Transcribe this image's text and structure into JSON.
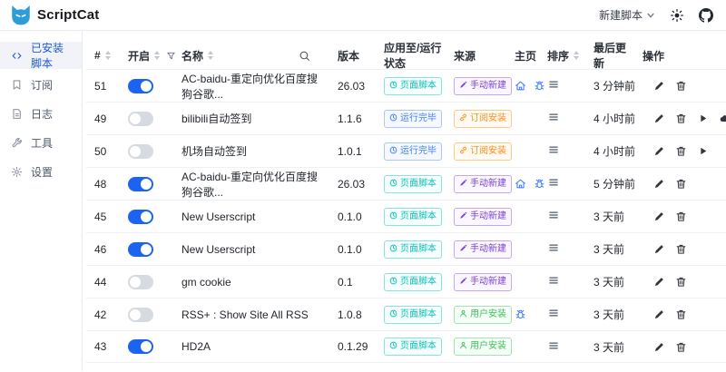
{
  "app": {
    "name": "ScriptCat"
  },
  "header": {
    "new_script_button": "新建脚本",
    "icons": [
      "chevron-down-icon",
      "theme-sun-icon",
      "github-icon"
    ]
  },
  "sidebar": {
    "items": [
      {
        "label": "已安装脚本",
        "icon": "code-icon",
        "active": true
      },
      {
        "label": "订阅",
        "icon": "subscribe-icon",
        "active": false
      },
      {
        "label": "日志",
        "icon": "logs-icon",
        "active": false
      },
      {
        "label": "工具",
        "icon": "tools-icon",
        "active": false
      },
      {
        "label": "设置",
        "icon": "settings-icon",
        "active": false
      }
    ]
  },
  "table": {
    "columns": [
      {
        "label": "#",
        "sortable": true
      },
      {
        "label": "开启",
        "sortable": true,
        "filterable": true
      },
      {
        "label": "名称",
        "sortable": true,
        "searchable": true
      },
      {
        "label": "版本"
      },
      {
        "label": "应用至/运行状态"
      },
      {
        "label": "来源"
      },
      {
        "label": "主页"
      },
      {
        "label": "排序",
        "sortable": true
      },
      {
        "label": "最后更新"
      },
      {
        "label": "操作"
      }
    ],
    "rows": [
      {
        "id": "51",
        "enabled": true,
        "name": "AC-baidu-重定向优化百度搜狗谷歌...",
        "version": "26.03",
        "status": {
          "label": "页面脚本",
          "kind": "page",
          "icon": "clock-icon"
        },
        "source": {
          "label": "手动新建",
          "kind": "manual",
          "icon": "pencil-icon"
        },
        "homepage_icons": [
          "home-icon",
          "bug-icon"
        ],
        "updated": "3 分钟前",
        "actions": [
          "edit-icon",
          "delete-icon"
        ]
      },
      {
        "id": "49",
        "enabled": false,
        "name": "bilibili自动签到",
        "version": "1.1.6",
        "status": {
          "label": "运行完毕",
          "kind": "run",
          "icon": "clock-icon"
        },
        "source": {
          "label": "订阅安装",
          "kind": "subscribe",
          "icon": "link-icon"
        },
        "homepage_icons": [],
        "updated": "4 小时前",
        "actions": [
          "edit-icon",
          "delete-icon",
          "run-icon",
          "cloud-icon"
        ]
      },
      {
        "id": "50",
        "enabled": false,
        "name": "机场自动签到",
        "version": "1.0.1",
        "status": {
          "label": "运行完毕",
          "kind": "run",
          "icon": "clock-icon"
        },
        "source": {
          "label": "订阅安装",
          "kind": "subscribe",
          "icon": "link-icon"
        },
        "homepage_icons": [],
        "updated": "4 小时前",
        "actions": [
          "edit-icon",
          "delete-icon",
          "run-icon"
        ]
      },
      {
        "id": "48",
        "enabled": true,
        "name": "AC-baidu-重定向优化百度搜狗谷歌...",
        "version": "26.03",
        "status": {
          "label": "页面脚本",
          "kind": "page",
          "icon": "clock-icon"
        },
        "source": {
          "label": "手动新建",
          "kind": "manual",
          "icon": "pencil-icon"
        },
        "homepage_icons": [
          "home-icon",
          "bug-icon"
        ],
        "updated": "5 分钟前",
        "actions": [
          "edit-icon",
          "delete-icon"
        ]
      },
      {
        "id": "45",
        "enabled": true,
        "name": "New Userscript",
        "version": "0.1.0",
        "status": {
          "label": "页面脚本",
          "kind": "page",
          "icon": "clock-icon"
        },
        "source": {
          "label": "手动新建",
          "kind": "manual",
          "icon": "pencil-icon"
        },
        "homepage_icons": [],
        "updated": "3 天前",
        "actions": [
          "edit-icon",
          "delete-icon"
        ]
      },
      {
        "id": "46",
        "enabled": true,
        "name": "New Userscript",
        "version": "0.1.0",
        "status": {
          "label": "页面脚本",
          "kind": "page",
          "icon": "clock-icon"
        },
        "source": {
          "label": "手动新建",
          "kind": "manual",
          "icon": "pencil-icon"
        },
        "homepage_icons": [],
        "updated": "3 天前",
        "actions": [
          "edit-icon",
          "delete-icon"
        ]
      },
      {
        "id": "44",
        "enabled": false,
        "name": "gm cookie",
        "version": "0.1",
        "status": {
          "label": "页面脚本",
          "kind": "page",
          "icon": "clock-icon"
        },
        "source": {
          "label": "手动新建",
          "kind": "manual",
          "icon": "pencil-icon"
        },
        "homepage_icons": [],
        "updated": "3 天前",
        "actions": [
          "edit-icon",
          "delete-icon"
        ]
      },
      {
        "id": "42",
        "enabled": false,
        "name": "RSS+ : Show Site All RSS",
        "version": "1.0.8",
        "status": {
          "label": "页面脚本",
          "kind": "page",
          "icon": "clock-icon"
        },
        "source": {
          "label": "用户安装",
          "kind": "user",
          "icon": "user-icon"
        },
        "homepage_icons": [
          "bug-icon"
        ],
        "updated": "3 天前",
        "actions": [
          "edit-icon",
          "delete-icon"
        ]
      },
      {
        "id": "43",
        "enabled": true,
        "name": "HD2A",
        "version": "0.1.29",
        "status": {
          "label": "页面脚本",
          "kind": "page",
          "icon": "clock-icon"
        },
        "source": {
          "label": "用户安装",
          "kind": "user",
          "icon": "user-icon"
        },
        "homepage_icons": [],
        "updated": "3 天前",
        "actions": [
          "edit-icon",
          "delete-icon"
        ]
      }
    ]
  },
  "colors": {
    "primary": "#1d63f2",
    "logo_blue": "#2d9cdb",
    "sidebar_active_bg": "#f2f3f8",
    "toggle_on": "#1d63f2",
    "toggle_off": "#d6dae1",
    "badge_page": "#0fbfbc",
    "badge_run": "#4080ff",
    "badge_manual": "#7b3fd6",
    "badge_subscribe": "#ff8d1a",
    "badge_user": "#3fbf5a",
    "homepage_icon": "#4080ff",
    "row_border": "#eef0f3"
  }
}
